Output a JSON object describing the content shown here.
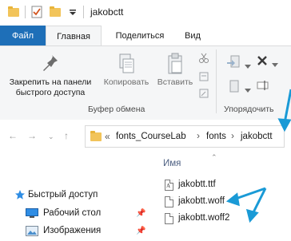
{
  "window": {
    "title": "jakobctt"
  },
  "ribbon_tabs": {
    "file": "Файл",
    "home": "Главная",
    "share": "Поделиться",
    "view": "Вид"
  },
  "ribbon": {
    "pin_label": "Закрепить на панели быстрого доступа",
    "copy_label": "Копировать",
    "paste_label": "Вставить",
    "clipboard_group": "Буфер обмена",
    "organize_group": "Упорядочить"
  },
  "address_bar": {
    "overflow": "«",
    "crumbs": [
      "fonts_CourseLab",
      "fonts",
      "jakobctt"
    ],
    "separator": "›"
  },
  "nav_pane": {
    "items": [
      {
        "label": "Быстрый доступ",
        "icon": "star-icon"
      },
      {
        "label": "Рабочий стол",
        "icon": "desktop-icon"
      },
      {
        "label": "Изображения",
        "icon": "pictures-icon"
      }
    ]
  },
  "file_list": {
    "column_name": "Имя",
    "files": [
      {
        "name": "jakobtt.ttf",
        "icon": "font-file-icon"
      },
      {
        "name": "jakobtt.woff",
        "icon": "file-icon"
      },
      {
        "name": "jakobtt.woff2",
        "icon": "file-icon"
      }
    ]
  },
  "colors": {
    "accent": "#1e6fb8",
    "annotation_arrows": "#1a9ad6",
    "folder": "#f2c45a"
  }
}
